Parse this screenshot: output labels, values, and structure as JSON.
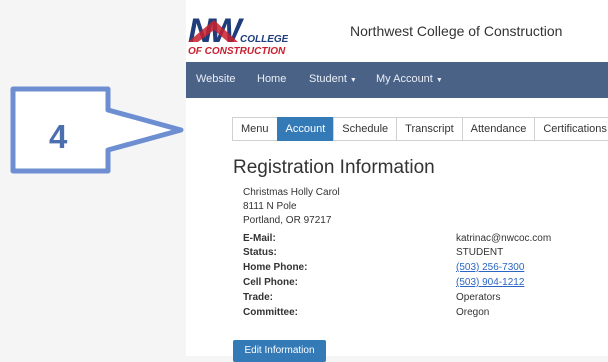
{
  "logo": {
    "letters": "NW",
    "line1": "COLLEGE",
    "line2": "OF CONSTRUCTION"
  },
  "header": {
    "title": "Northwest College of Construction"
  },
  "nav": {
    "items": [
      {
        "label": "Website"
      },
      {
        "label": "Home"
      },
      {
        "label": "Student"
      },
      {
        "label": "My Account"
      }
    ]
  },
  "callout": {
    "number": "4"
  },
  "tabs": [
    "Menu",
    "Account",
    "Schedule",
    "Transcript",
    "Attendance",
    "Certifications"
  ],
  "registration": {
    "title": "Registration Information",
    "name": "Christmas Holly Carol",
    "street": "8111 N Pole",
    "city": "Portland, OR 97217",
    "fields": [
      {
        "label": "E-Mail:",
        "value": "katrinac@nwcoc.com"
      },
      {
        "label": "Status:",
        "value": "STUDENT"
      },
      {
        "label": "Home Phone:",
        "value": "(503) 256-7300"
      },
      {
        "label": "Cell Phone:",
        "value": "(503) 904-1212"
      },
      {
        "label": "Trade:",
        "value": "Operators"
      },
      {
        "label": "Committee:",
        "value": "Oregon"
      }
    ],
    "edit_label": "Edit Information"
  },
  "colors": {
    "navbar": "#4b6287",
    "accent": "#337ab7",
    "logo_red": "#c8202e",
    "logo_navy": "#1f3d7a",
    "callout": "#4c6faf"
  }
}
